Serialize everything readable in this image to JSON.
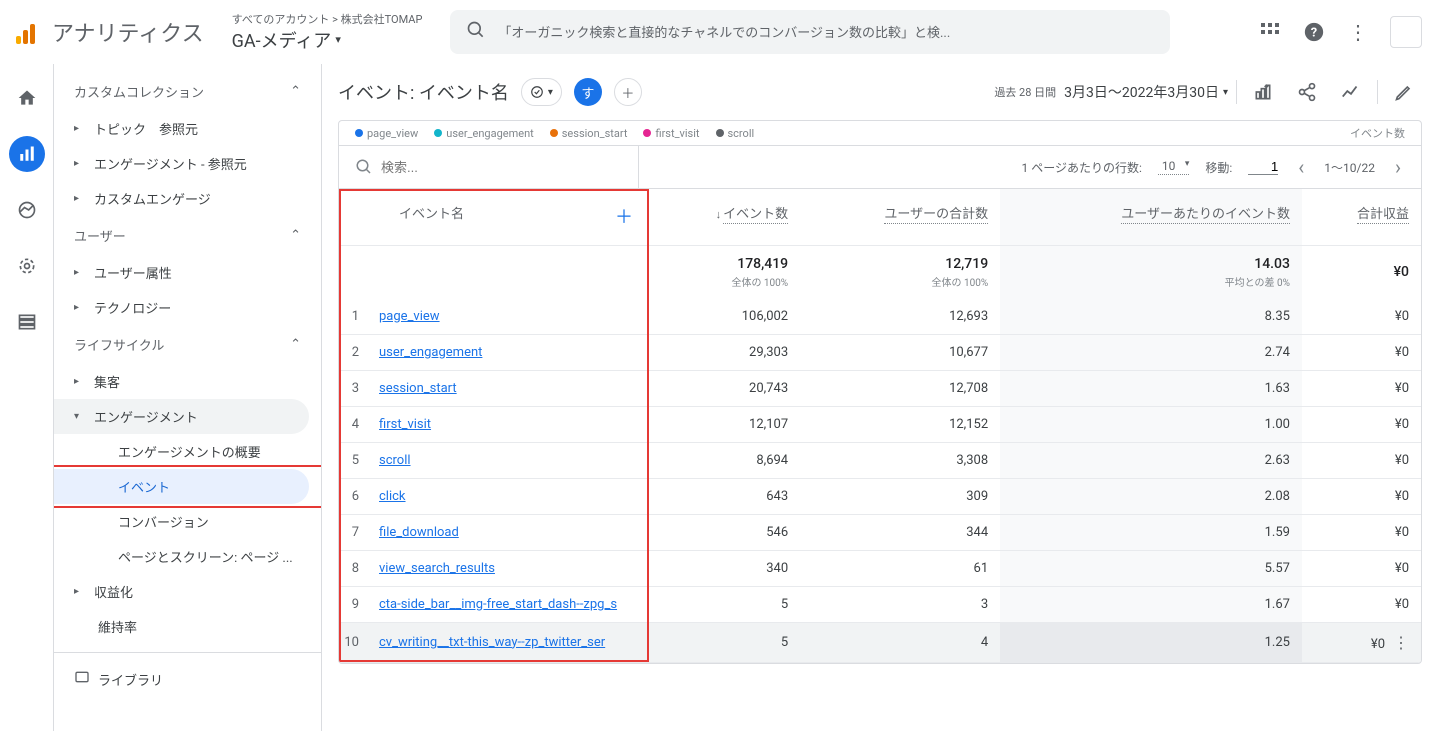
{
  "header": {
    "app_name": "アナリティクス",
    "breadcrumb": "すべてのアカウント > 株式会社TOMAP",
    "property": "GA-メディア",
    "search_placeholder": "「オーガニック検索と直接的なチャネルでのコンバージョン数の比較」と検..."
  },
  "sidebar": {
    "group_custom": "カスタムコレクション",
    "items_custom": [
      "トピック　参照元",
      "エンゲージメント - 参照元",
      "カスタムエンゲージ"
    ],
    "group_user": "ユーザー",
    "items_user": [
      "ユーザー属性",
      "テクノロジー"
    ],
    "group_lifecycle": "ライフサイクル",
    "lifecycle_acquisition": "集客",
    "lifecycle_engagement": "エンゲージメント",
    "engagement_sub": [
      "エンゲージメントの概要",
      "イベント",
      "コンバージョン",
      "ページとスクリーン: ページ ..."
    ],
    "lifecycle_monetization": "収益化",
    "lifecycle_retention": "維持率",
    "library": "ライブラリ"
  },
  "toolbar": {
    "title": "イベント: イベント名",
    "chip_all": "す",
    "date_label": "過去 28 日間",
    "date_range": "3月3日～2022年3月30日"
  },
  "legend": {
    "items": [
      "page_view",
      "user_engagement",
      "session_start",
      "first_visit",
      "scroll"
    ],
    "right": "イベント数",
    "colors": [
      "#1a73e8",
      "#12b5cb",
      "#e8710a",
      "#e52592",
      "#5f6368"
    ]
  },
  "table_controls": {
    "search_placeholder": "検索...",
    "rows_per_page_label": "1 ページあたりの行数:",
    "rows_per_page": "10",
    "goto_label": "移動:",
    "goto_value": "1",
    "range": "1～10/22"
  },
  "table": {
    "col_name": "イベント名",
    "col_events": "イベント数",
    "col_users": "ユーザーの合計数",
    "col_per_user": "ユーザーあたりのイベント数",
    "col_revenue": "合計収益",
    "totals": {
      "events": "178,419",
      "events_sub": "全体の 100%",
      "users": "12,719",
      "users_sub": "全体の 100%",
      "per_user": "14.03",
      "per_user_sub": "平均との差 0%",
      "revenue": "¥0"
    },
    "rows": [
      {
        "n": "1",
        "name": "page_view",
        "events": "106,002",
        "users": "12,693",
        "per_user": "8.35",
        "revenue": "¥0"
      },
      {
        "n": "2",
        "name": "user_engagement",
        "events": "29,303",
        "users": "10,677",
        "per_user": "2.74",
        "revenue": "¥0"
      },
      {
        "n": "3",
        "name": "session_start",
        "events": "20,743",
        "users": "12,708",
        "per_user": "1.63",
        "revenue": "¥0"
      },
      {
        "n": "4",
        "name": "first_visit",
        "events": "12,107",
        "users": "12,152",
        "per_user": "1.00",
        "revenue": "¥0"
      },
      {
        "n": "5",
        "name": "scroll",
        "events": "8,694",
        "users": "3,308",
        "per_user": "2.63",
        "revenue": "¥0"
      },
      {
        "n": "6",
        "name": "click",
        "events": "643",
        "users": "309",
        "per_user": "2.08",
        "revenue": "¥0"
      },
      {
        "n": "7",
        "name": "file_download",
        "events": "546",
        "users": "344",
        "per_user": "1.59",
        "revenue": "¥0"
      },
      {
        "n": "8",
        "name": "view_search_results",
        "events": "340",
        "users": "61",
        "per_user": "5.57",
        "revenue": "¥0"
      },
      {
        "n": "9",
        "name": "cta-side_bar__img-free_start_dash--zpg_s",
        "events": "5",
        "users": "3",
        "per_user": "1.67",
        "revenue": "¥0"
      },
      {
        "n": "10",
        "name": "cv_writing__txt-this_way--zp_twitter_ser",
        "events": "5",
        "users": "4",
        "per_user": "1.25",
        "revenue": "¥0"
      }
    ]
  }
}
